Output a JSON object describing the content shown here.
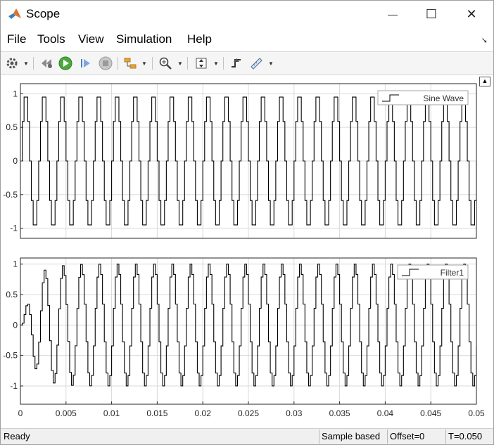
{
  "window": {
    "title": "Scope",
    "minimize_glyph": "—",
    "maximize_glyph": "☐",
    "close_glyph": "✕"
  },
  "menu": {
    "items": [
      "File",
      "Tools",
      "View",
      "Simulation",
      "Help"
    ]
  },
  "toolbar": {
    "icons": [
      "settings-icon",
      "step-back-icon",
      "run-icon",
      "step-forward-icon",
      "stop-icon",
      "highlight-block-icon",
      "zoom-icon",
      "scale-axes-icon",
      "triggers-icon",
      "cursor-measurements-icon"
    ]
  },
  "statusbar": {
    "status": "Ready",
    "mode": "Sample based",
    "offset": "Offset=0",
    "time": "T=0.050"
  },
  "colors": {
    "line": "#000000",
    "grid": "#d9d9d9",
    "axes_border": "#262626"
  },
  "chart_data": [
    {
      "type": "line",
      "legend": "Sine Wave",
      "legend_position": "top-right",
      "xlim": [
        0,
        0.05
      ],
      "ylim": [
        -1.15,
        1.15
      ],
      "yticks": [
        1,
        0.5,
        0,
        -0.5,
        -1
      ],
      "ytick_labels": [
        "1",
        "0.5",
        "0",
        "-0.5",
        "-1"
      ],
      "grid": true,
      "signal": {
        "kind": "sine",
        "frequency_hz": 500,
        "amplitude": 1,
        "sample_time": 0.0002
      }
    },
    {
      "type": "line",
      "legend": "Filter1",
      "legend_position": "top-right",
      "xlim": [
        0,
        0.05
      ],
      "ylim": [
        -1.3,
        1.1
      ],
      "xticks": [
        0,
        0.005,
        0.01,
        0.015,
        0.02,
        0.025,
        0.03,
        0.035,
        0.04,
        0.045,
        0.05
      ],
      "xtick_labels": [
        "0",
        "0.005",
        "0.01",
        "0.015",
        "0.02",
        "0.025",
        "0.03",
        "0.035",
        "0.04",
        "0.045",
        "0.05"
      ],
      "yticks": [
        1,
        0.5,
        0,
        -0.5,
        -1
      ],
      "ytick_labels": [
        "1",
        "0.5",
        "0",
        "-0.5",
        "-1"
      ],
      "grid": true,
      "signal": {
        "kind": "filtered-sine",
        "frequency_hz": 500,
        "amplitude": 1,
        "sample_time": 0.0002
      }
    }
  ]
}
